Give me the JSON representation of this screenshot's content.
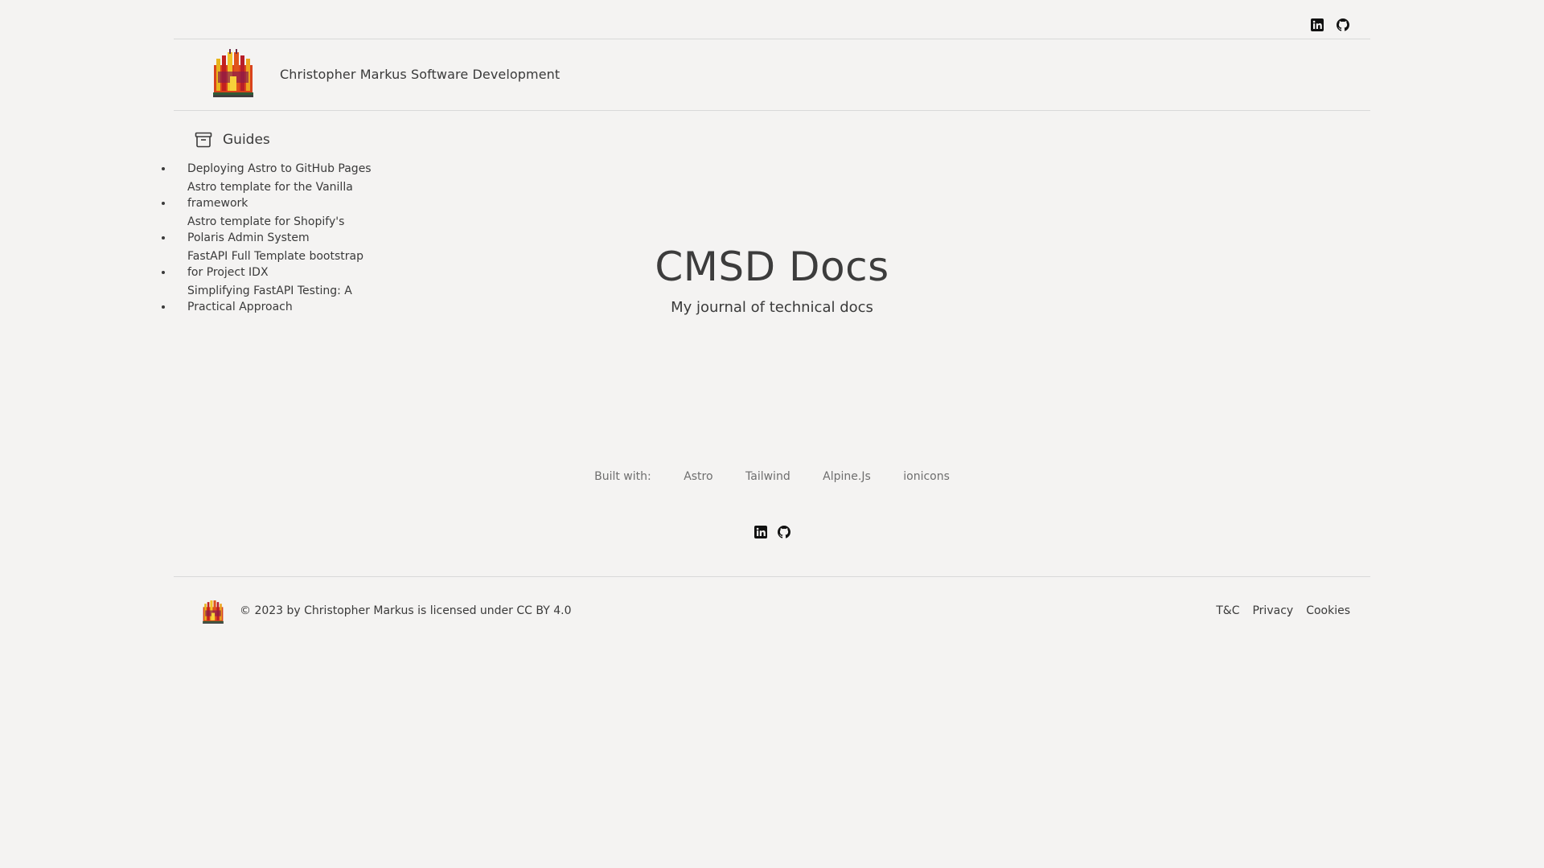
{
  "site": {
    "title": "Christopher Markus Software Development"
  },
  "social": {
    "linkedin": "linkedin-icon",
    "github": "github-icon"
  },
  "sidebar": {
    "heading": "Guides",
    "heading_icon": "archive-icon",
    "items": [
      {
        "label": "Deploying Astro to GitHub Pages"
      },
      {
        "label": "Astro template for the Vanilla framework"
      },
      {
        "label": "Astro template for Shopify's Polaris Admin System"
      },
      {
        "label": "FastAPI Full Template bootstrap for Project IDX"
      },
      {
        "label": "Simplifying FastAPI Testing: A Practical Approach"
      }
    ]
  },
  "hero": {
    "title": "CMSD Docs",
    "subtitle": "My journal of technical docs"
  },
  "built_with": {
    "label": "Built with:",
    "items": [
      "Astro",
      "Tailwind",
      "Alpine.Js",
      "ionicons"
    ]
  },
  "footer": {
    "copyright": "© 2023 by Christopher Markus is licensed under CC BY 4.0",
    "links": [
      "T&C",
      "Privacy",
      "Cookies"
    ]
  },
  "colors": {
    "background": "#f4f3f2",
    "text": "#3a3a3a",
    "muted": "#6e6e6e",
    "divider": "#d9d9d9"
  }
}
